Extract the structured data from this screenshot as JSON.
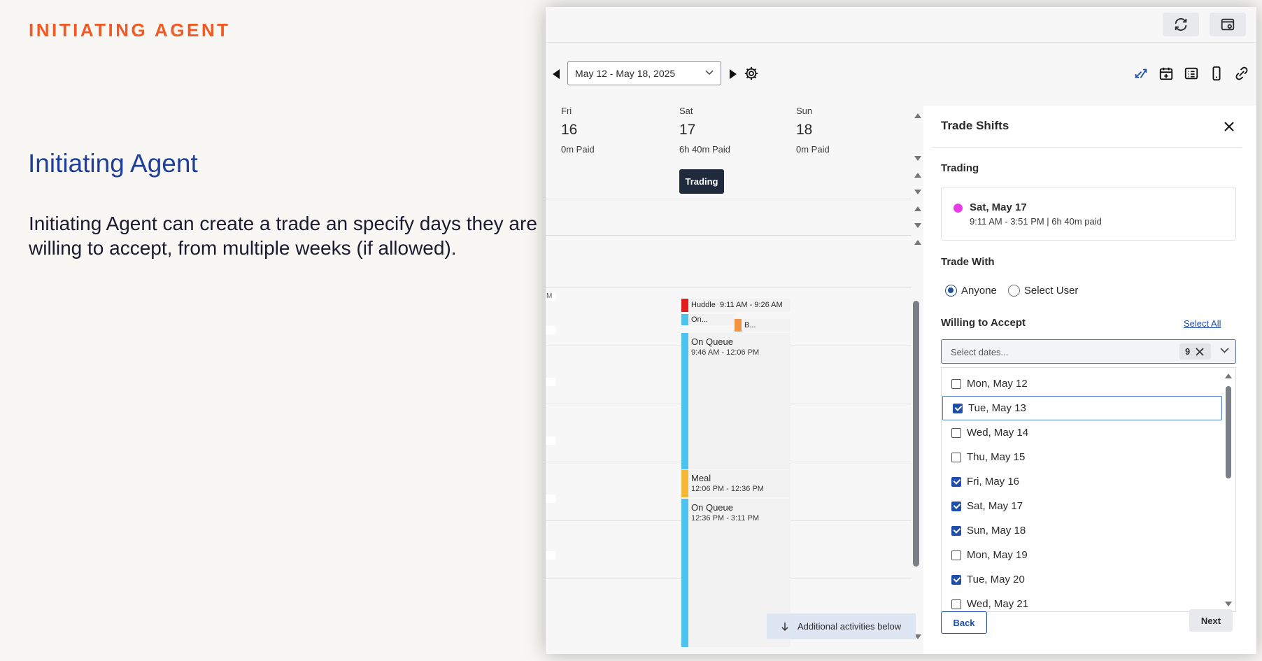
{
  "slide": {
    "eyebrow": "INITIATING AGENT",
    "title": "Initiating Agent",
    "body": "Initiating Agent can create a trade an specify days they are willing to accept, from multiple weeks (if allowed)."
  },
  "toolbar": {
    "icons": [
      "refresh-icon",
      "window-settings-icon"
    ]
  },
  "schedule": {
    "date_range": "May 12 - May 18, 2025",
    "view_icons": [
      "trade-shifts-icon",
      "calendar-add-icon",
      "list-icon",
      "mobile-icon",
      "link-icon"
    ],
    "days": [
      {
        "name": "Fri",
        "num": "16",
        "paid": "0m Paid"
      },
      {
        "name": "Sat",
        "num": "17",
        "paid": "6h 40m Paid"
      },
      {
        "name": "Sun",
        "num": "18",
        "paid": "0m Paid"
      }
    ],
    "trading_badge": "Trading",
    "activities": [
      {
        "name": "Huddle",
        "time": "9:11 AM - 9:26 AM",
        "color": "#e31b1b"
      },
      {
        "name": "On...",
        "time": "",
        "color": "#4cc3ee"
      },
      {
        "name": "B...",
        "time": "",
        "color": "#f0923e"
      },
      {
        "name": "On Queue",
        "time": "9:46 AM - 12:06 PM",
        "color": "#4cc3ee"
      },
      {
        "name": "Meal",
        "time": "12:06 PM - 12:36 PM",
        "color": "#f6b735"
      },
      {
        "name": "On Queue",
        "time": "12:36 PM - 3:11 PM",
        "color": "#4cc3ee"
      }
    ],
    "partial_label": "M",
    "more_below": "Additional activities below"
  },
  "trade_panel": {
    "title": "Trade Shifts",
    "trading_label": "Trading",
    "shift": {
      "day": "Sat, May 17",
      "time": "9:11 AM - 3:51 PM | 6h 40m paid",
      "color": "#e63de6"
    },
    "trade_with_label": "Trade With",
    "options": [
      {
        "label": "Anyone",
        "selected": true
      },
      {
        "label": "Select User",
        "selected": false
      }
    ],
    "willing_label": "Willing to Accept",
    "select_all": "Select All",
    "dates_placeholder": "Select dates...",
    "selected_count": "9",
    "dates": [
      {
        "label": "Mon, May 12",
        "checked": false
      },
      {
        "label": "Tue, May 13",
        "checked": true
      },
      {
        "label": "Wed, May 14",
        "checked": false
      },
      {
        "label": "Thu, May 15",
        "checked": false
      },
      {
        "label": "Fri, May 16",
        "checked": true
      },
      {
        "label": "Sat, May 17",
        "checked": true
      },
      {
        "label": "Sun, May 18",
        "checked": true
      },
      {
        "label": "Mon, May 19",
        "checked": false
      },
      {
        "label": "Tue, May 20",
        "checked": true
      },
      {
        "label": "Wed, May 21",
        "checked": false
      }
    ],
    "back_label": "Back",
    "next_label": "Next"
  }
}
